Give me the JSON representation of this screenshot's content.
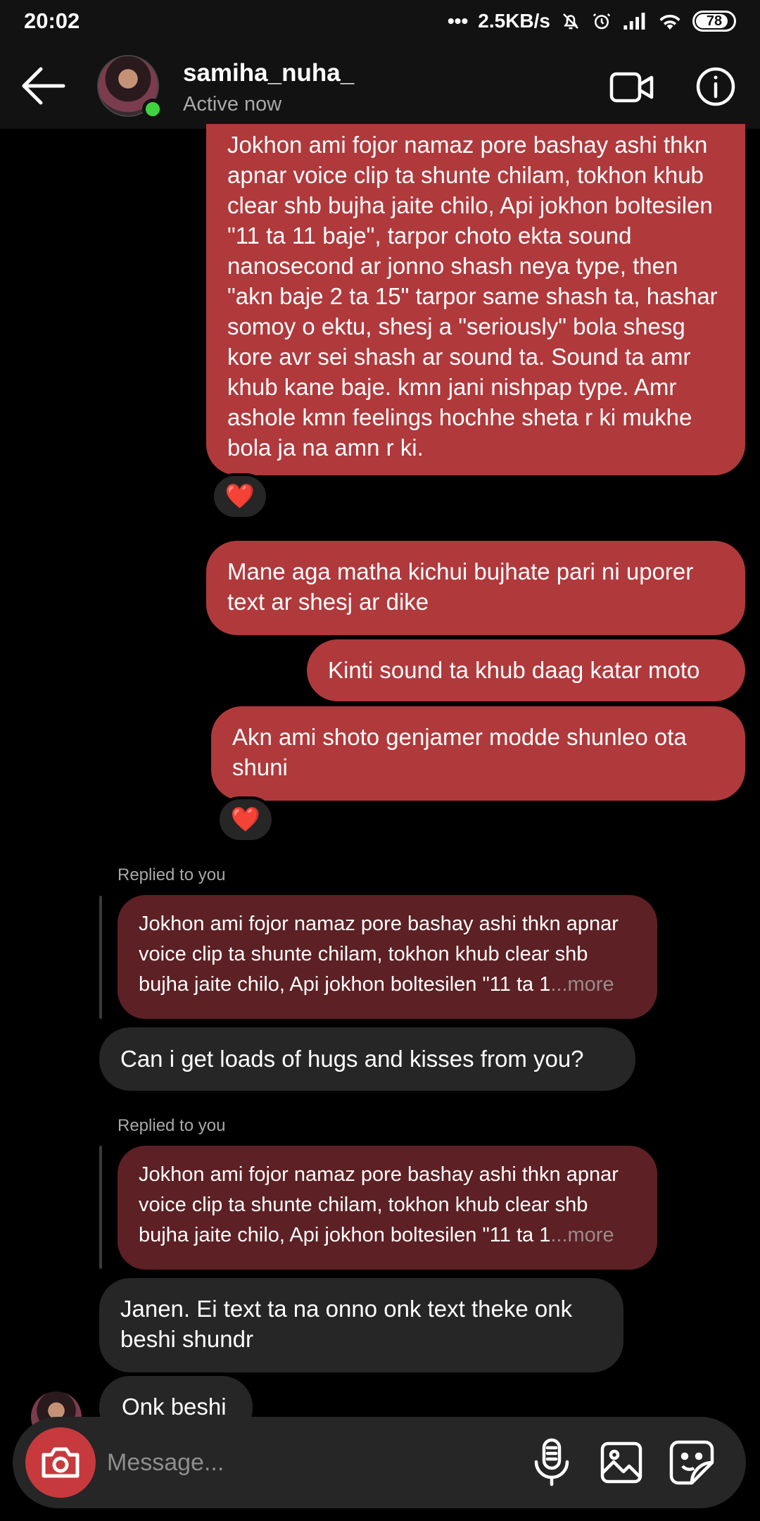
{
  "status_bar": {
    "time": "20:02",
    "network_speed": "2.5KB/s",
    "battery": "78",
    "icons": [
      "more-dots-icon",
      "mute-bell-icon",
      "alarm-icon",
      "signal-icon",
      "wifi-icon",
      "battery-icon"
    ]
  },
  "header": {
    "username": "samiha_nuha_",
    "status": "Active now",
    "icons": [
      "back-arrow-icon",
      "video-call-icon",
      "info-icon"
    ]
  },
  "messages": {
    "sent_1": "Jokhon ami fojor namaz pore bashay ashi thkn apnar voice clip ta   shunte chilam, tokhon khub clear shb bujha jaite chilo, Api jokhon boltesilen \"11 ta 11 baje\", tarpor choto ekta sound nanosecond ar jonno shash neya type, then \"akn baje 2 ta 15\" tarpor same shash ta, hashar somoy o ektu, shesj a \"seriously\" bola shesg kore avr sei shash ar sound ta. Sound ta amr khub kane baje. kmn jani nishpap type. Amr ashole kmn feelings hochhe sheta r ki mukhe bola ja na amn r ki.",
    "reaction_1": "❤️",
    "sent_2": "Mane aga matha kichui bujhate pari ni uporer text ar shesj ar dike",
    "sent_3": "Kinti sound ta khub daag katar moto",
    "sent_4": "Akn ami shoto genjamer modde shunleo ota shuni",
    "reaction_2": "❤️",
    "reply_1_label": "Replied to you",
    "reply_1_quote": "Jokhon ami fojor namaz pore bashay ashi thkn apnar voice clip ta   shunte chilam, tokhon khub clear shb bujha jaite chilo, Api jokhon boltesilen \"11 ta 1",
    "reply_1_more": "...more",
    "recv_1": "Can i get loads of hugs and kisses from you?",
    "reply_2_label": "Replied to you",
    "reply_2_quote": "Jokhon ami fojor namaz pore bashay ashi thkn apnar voice clip ta   shunte chilam, tokhon khub clear shb bujha jaite chilo, Api jokhon boltesilen \"11 ta 1",
    "reply_2_more": "...more",
    "recv_2": "Janen. Ei text ta na onno onk text theke onk beshi shundr",
    "recv_3": "Onk beshi"
  },
  "composer": {
    "placeholder": "Message...",
    "icons": [
      "camera-icon",
      "microphone-icon",
      "gallery-icon",
      "sticker-icon"
    ]
  },
  "colors": {
    "sent_bubble": "#b0393c",
    "received_bubble": "#262626",
    "quoted_bubble": "#5d2024",
    "online": "#3fd33f"
  }
}
